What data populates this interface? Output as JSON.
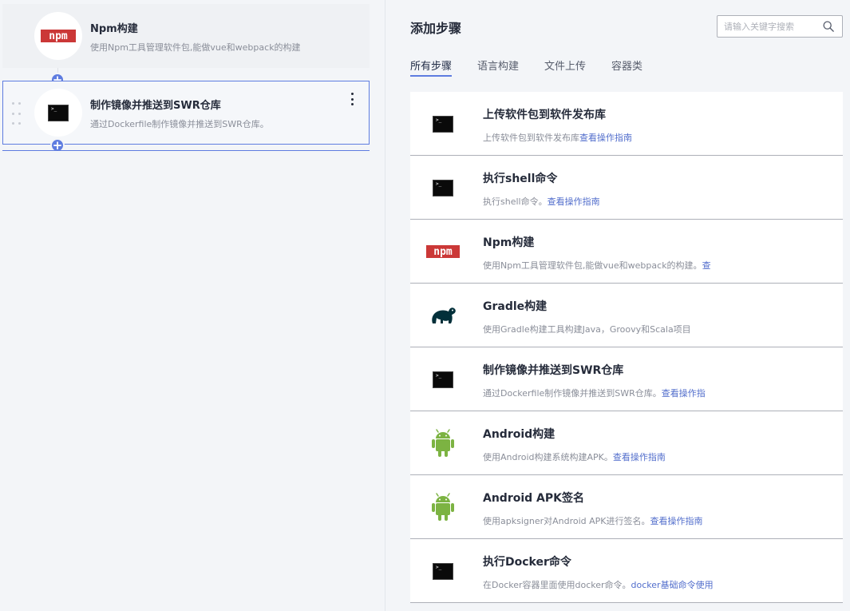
{
  "pipeline_steps": [
    {
      "title": "Npm构建",
      "desc": "使用Npm工具管理软件包,能做vue和webpack的构建",
      "icon": "npm-logo",
      "icon_text": "npm"
    },
    {
      "title": "制作镜像并推送到SWR仓库",
      "desc": "通过Dockerfile制作镜像并推送到SWR仓库。",
      "icon": "terminal-icon"
    }
  ],
  "add_step_symbol": "+",
  "panel": {
    "title": "添加步骤",
    "search_placeholder": "请输入关键字搜索"
  },
  "tabs": [
    {
      "label": "所有步骤",
      "active": true
    },
    {
      "label": "语言构建",
      "active": false
    },
    {
      "label": "文件上传",
      "active": false
    },
    {
      "label": "容器类",
      "active": false
    }
  ],
  "catalog": [
    {
      "title": "上传软件包到软件发布库",
      "desc": "上传软件包到软件发布库",
      "link": "查看操作指南",
      "icon": "terminal-icon"
    },
    {
      "title": "执行shell命令",
      "desc": "执行shell命令。",
      "link": "查看操作指南",
      "icon": "terminal-icon"
    },
    {
      "title": "Npm构建",
      "desc": "使用Npm工具管理软件包,能做vue和webpack的构建。",
      "link": "查",
      "icon": "npm-logo"
    },
    {
      "title": "Gradle构建",
      "desc": "使用Gradle构建工具构建Java，Groovy和Scala项目",
      "link": "",
      "icon": "gradle-icon"
    },
    {
      "title": "制作镜像并推送到SWR仓库",
      "desc": "通过Dockerfile制作镜像并推送到SWR仓库。",
      "link": "查看操作指",
      "icon": "terminal-icon"
    },
    {
      "title": "Android构建",
      "desc": "使用Android构建系统构建APK。",
      "link": "查看操作指南",
      "icon": "android-icon"
    },
    {
      "title": "Android APK签名",
      "desc": "使用apksigner对Android APK进行签名。",
      "link": "查看操作指南",
      "icon": "android-icon"
    },
    {
      "title": "执行Docker命令",
      "desc": "在Docker容器里面使用docker命令。",
      "link": "docker基础命令使用",
      "icon": "terminal-icon"
    }
  ],
  "colors": {
    "accent": "#5e7ce0",
    "link": "#526ecc",
    "npm_red": "#cb3837",
    "android_green": "#7cb342",
    "gradle_dark": "#02303a"
  }
}
